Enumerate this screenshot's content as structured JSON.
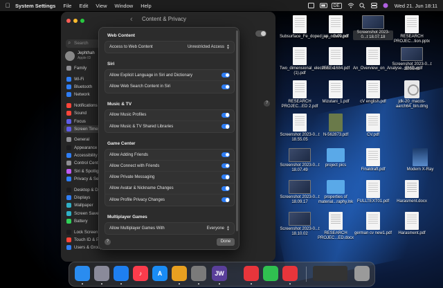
{
  "menubar": {
    "app_name": "System Settings",
    "menus": [
      "File",
      "Edit",
      "View",
      "Window",
      "Help"
    ],
    "input_badge": "DE",
    "datetime": "Wed 21. Jun  18:11"
  },
  "window": {
    "title": "Content & Privacy",
    "search_placeholder": "Search",
    "account_name": "Jephthah",
    "account_sub": "Apple ID",
    "help_label": "?"
  },
  "sidebar": {
    "items": [
      {
        "label": "Family",
        "color": "#8e8e93"
      },
      {
        "label": "Wi-Fi",
        "color": "#2f7ef6"
      },
      {
        "label": "Bluetooth",
        "color": "#2f7ef6"
      },
      {
        "label": "Network",
        "color": "#2f7ef6"
      },
      {
        "label": "Notifications",
        "color": "#ff453a"
      },
      {
        "label": "Sound",
        "color": "#ff453a"
      },
      {
        "label": "Focus",
        "color": "#5e5ce6"
      },
      {
        "label": "Screen Time",
        "color": "#5e5ce6"
      },
      {
        "label": "General",
        "color": "#8e8e93"
      },
      {
        "label": "Appearance",
        "color": "#1c1c1e"
      },
      {
        "label": "Accessibility",
        "color": "#2f7ef6"
      },
      {
        "label": "Control Centre",
        "color": "#8e8e93"
      },
      {
        "label": "Siri & Spotlight",
        "color": "#bf5af2"
      },
      {
        "label": "Privacy & Security",
        "color": "#2f7ef6"
      },
      {
        "label": "Desktop & Dock",
        "color": "#1c1c1e"
      },
      {
        "label": "Displays",
        "color": "#2f7ef6"
      },
      {
        "label": "Wallpaper",
        "color": "#30b0c7"
      },
      {
        "label": "Screen Saver",
        "color": "#30b0c7"
      },
      {
        "label": "Battery",
        "color": "#30d158"
      },
      {
        "label": "Lock Screen",
        "color": "#1c1c1e"
      },
      {
        "label": "Touch ID & Password",
        "color": "#ff453a"
      },
      {
        "label": "Users & Groups",
        "color": "#2f7ef6"
      }
    ]
  },
  "sheet": {
    "sections": [
      {
        "title": "Web Content",
        "rows": [
          {
            "label": "Access to Web Content",
            "value": "Unrestricted Access"
          }
        ]
      },
      {
        "title": "Siri",
        "rows": [
          {
            "label": "Allow Explicit Language in Siri and Dictionary",
            "on": true
          },
          {
            "label": "Allow Web Search Content in Siri",
            "on": true
          }
        ]
      },
      {
        "title": "Music & TV",
        "rows": [
          {
            "label": "Allow Music Profiles",
            "on": true
          },
          {
            "label": "Allow Music & TV Shared Libraries",
            "on": true
          }
        ]
      },
      {
        "title": "Game Center",
        "rows": [
          {
            "label": "Allow Adding Friends",
            "on": true
          },
          {
            "label": "Allow Connect with Friends",
            "on": true
          },
          {
            "label": "Allow Private Messaging",
            "on": true
          },
          {
            "label": "Allow Avatar & Nickname Changes",
            "on": true
          },
          {
            "label": "Allow Profile Privacy Changes",
            "on": true
          }
        ]
      },
      {
        "title": "Multiplayer Games",
        "rows": [
          {
            "label": "Allow Multiplayer Games With",
            "value": "Everyone"
          }
        ]
      }
    ],
    "help_label": "?",
    "done_label": "Done"
  },
  "desktop": {
    "files": [
      {
        "name": "Subsurface_Fe_doped_se....GaN.pdf",
        "kind": "pdf"
      },
      {
        "name": "jap_nov00.pdf",
        "kind": "pdf"
      },
      {
        "name": "Screenshot 2023-0...t 18.07.18",
        "kind": "shot"
      },
      {
        "name": "RESEARCH PROJEC...tion.pptx",
        "kind": "pdf"
      },
      {
        "name": "Two_dimensional_electron...e (1).pdf",
        "kind": "pdf"
      },
      {
        "name": "JEEE-1684.pdf",
        "kind": "pdf"
      },
      {
        "name": "An_Overview_on_Analyse...EMTs.pdf",
        "kind": "pdf"
      },
      {
        "name": "Screenshot 2023-0...t 18.06.49",
        "kind": "shot"
      },
      {
        "name": "RESEARCH PROJEC...ED 2.pdf",
        "kind": "pdf"
      },
      {
        "name": "Mizutani_1.pdf",
        "kind": "pdf"
      },
      {
        "name": "cV english.pdf",
        "kind": "pdf"
      },
      {
        "name": "jdk-20_macos-aarch64_bin.dmg",
        "kind": "jdk"
      },
      {
        "name": "Screenshot 2023-0...t 18.55.05",
        "kind": "pdf"
      },
      {
        "name": "N-562873.pdf",
        "kind": "dark"
      },
      {
        "name": "CV.pdf",
        "kind": "pdf"
      },
      {
        "name": "Modern X-Ray",
        "kind": "cover"
      },
      {
        "name": "Screenshot 2023-0...t 18.07.49",
        "kind": "shot"
      },
      {
        "name": "project pics",
        "kind": "folder"
      },
      {
        "name": "Finaldraft.pdf",
        "kind": "pdf"
      },
      {
        "name": "Screenshot 2023-0...t 18.09.17",
        "kind": "shot"
      },
      {
        "name": "properties of material...raphy.lnk",
        "kind": "folder"
      },
      {
        "name": "FULLTEXT01.pdf",
        "kind": "pdf"
      },
      {
        "name": "Harasment.docx",
        "kind": "docx"
      },
      {
        "name": "Screenshot 2023-0...t 18.10.02",
        "kind": "shot"
      },
      {
        "name": "RESEARCH PROJEC...ED.docx",
        "kind": "docx"
      },
      {
        "name": "german cv new1.pdf",
        "kind": "pdf"
      },
      {
        "name": "Harasment.pdf",
        "kind": "pdf"
      }
    ]
  },
  "dock": {
    "apps": [
      {
        "name": "Finder",
        "color": "#2a8cf0",
        "glyph": ""
      },
      {
        "name": "Launchpad",
        "color": "#8a8a9a",
        "glyph": ""
      },
      {
        "name": "Safari",
        "color": "#1e7ff0",
        "glyph": ""
      },
      {
        "name": "Music",
        "color": "#fa3c4c",
        "glyph": "♪"
      },
      {
        "name": "App Store",
        "color": "#1a8cf5",
        "glyph": "A"
      },
      {
        "name": "Chrome",
        "color": "#e8a020",
        "glyph": ""
      },
      {
        "name": "System Settings",
        "color": "#7a7a7a",
        "glyph": ""
      },
      {
        "name": "JW Library",
        "color": "#5a3f9a",
        "glyph": "JW"
      },
      {
        "name": "AnyDesk",
        "color": "#e8353b",
        "glyph": ""
      },
      {
        "name": "FaceTime",
        "color": "#30c050",
        "glyph": ""
      },
      {
        "name": "AnyDesk 2",
        "color": "#e8353b",
        "glyph": ""
      },
      {
        "name": "Window preview",
        "color": "#333333",
        "glyph": ""
      },
      {
        "name": "Trash",
        "color": "#9a9a9a",
        "glyph": ""
      }
    ]
  }
}
